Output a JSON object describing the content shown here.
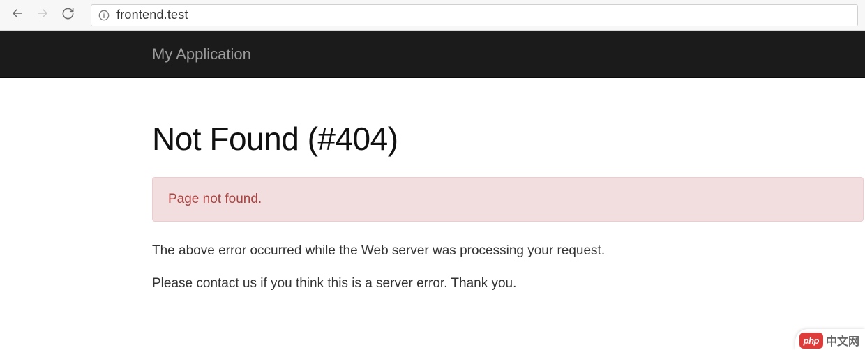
{
  "browser": {
    "url": "frontend.test"
  },
  "navbar": {
    "brand": "My Application"
  },
  "error": {
    "title": "Not Found (#404)",
    "alert": "Page not found.",
    "line1": "The above error occurred while the Web server was processing your request.",
    "line2": "Please contact us if you think this is a server error. Thank you."
  },
  "watermark": {
    "badge": "php",
    "text": "中文网"
  }
}
